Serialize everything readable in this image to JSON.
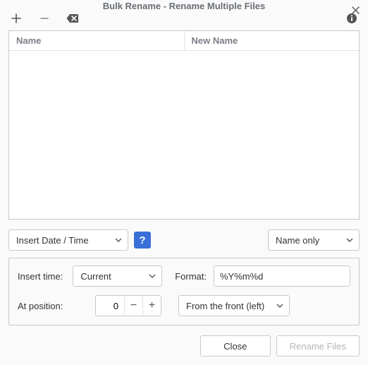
{
  "title": "Bulk Rename - Rename Multiple Files",
  "filelist": {
    "col_name": "Name",
    "col_newname": "New Name"
  },
  "mode_dropdown": {
    "label": "Insert Date / Time"
  },
  "scope_dropdown": {
    "label": "Name only"
  },
  "options": {
    "insert_time_label": "Insert time:",
    "insert_time_value": "Current",
    "format_label": "Format:",
    "format_value": "%Y%m%d",
    "position_label": "At position:",
    "position_value": "0",
    "direction_value": "From the front (left)"
  },
  "footer": {
    "close": "Close",
    "rename": "Rename Files"
  },
  "help_char": "?"
}
